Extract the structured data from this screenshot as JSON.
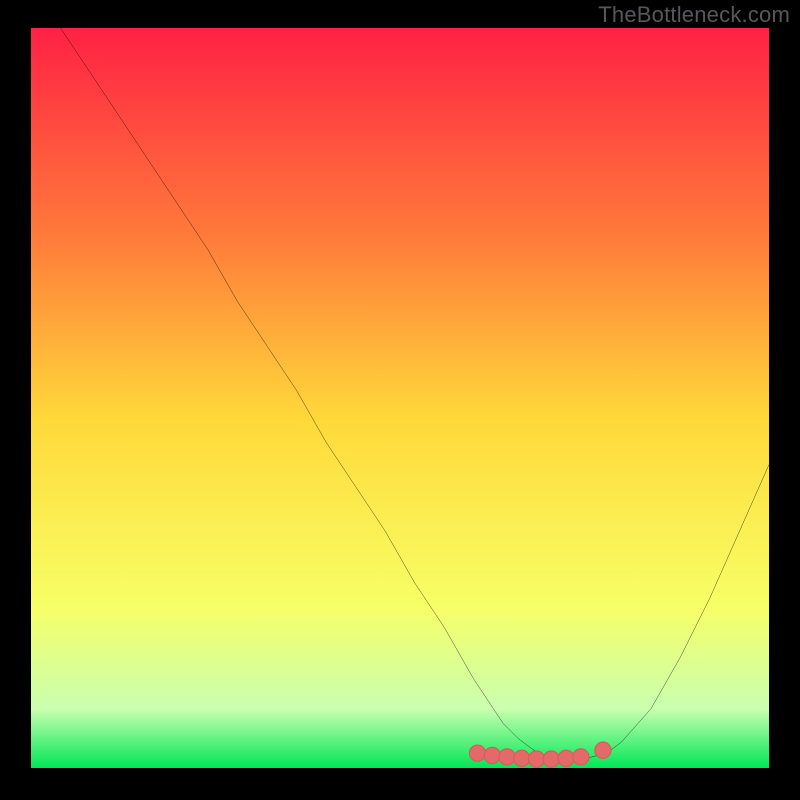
{
  "watermark": "TheBottleneck.com",
  "colors": {
    "frame_bg": "#000000",
    "gradient_top": "#ff2144",
    "gradient_mid1": "#ff7a3a",
    "gradient_mid2": "#ffd93a",
    "gradient_mid3": "#f7ff66",
    "gradient_mid4": "#c9ffb0",
    "gradient_bottom": "#00e756",
    "curve": "#000000",
    "marker_fill": "#e46a6a",
    "marker_stroke": "#d85a5a"
  },
  "chart_data": {
    "type": "line",
    "title": "",
    "xlabel": "",
    "ylabel": "",
    "xlim": [
      0,
      100
    ],
    "ylim": [
      0,
      100
    ],
    "series": [
      {
        "name": "bottleneck-curve",
        "x": [
          4,
          8,
          12,
          16,
          20,
          24,
          28,
          32,
          36,
          40,
          44,
          48,
          52,
          56,
          60,
          62,
          64,
          66,
          68,
          70,
          72,
          74,
          76,
          78,
          80,
          84,
          88,
          92,
          96,
          100
        ],
        "y": [
          100,
          94,
          88,
          82,
          76,
          70,
          63,
          57,
          51,
          44,
          38,
          32,
          25,
          19,
          12,
          9,
          6,
          4,
          2.5,
          1.5,
          1,
          1,
          1.5,
          2,
          3.5,
          8,
          15,
          23,
          32,
          41
        ]
      }
    ],
    "markers": {
      "name": "highlight-points",
      "x": [
        60.5,
        62.5,
        64.5,
        66.5,
        68.5,
        70.5,
        72.5,
        74.5,
        77.5
      ],
      "y": [
        2.0,
        1.7,
        1.5,
        1.3,
        1.2,
        1.2,
        1.3,
        1.5,
        2.4
      ],
      "r": 1.1
    }
  }
}
